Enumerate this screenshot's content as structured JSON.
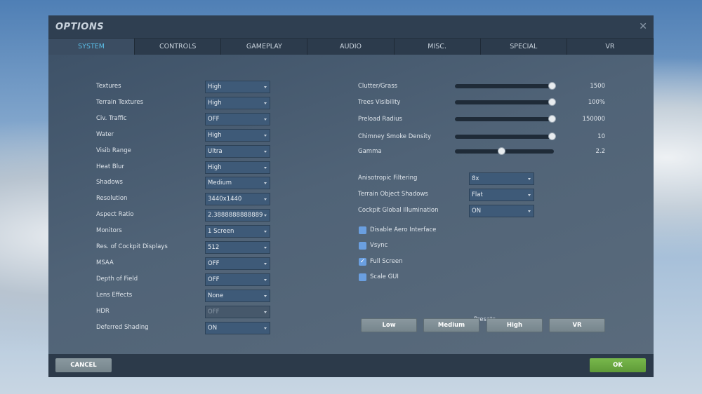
{
  "title": "OPTIONS",
  "tabs": [
    "SYSTEM",
    "CONTROLS",
    "GAMEPLAY",
    "AUDIO",
    "MISC.",
    "SPECIAL",
    "VR"
  ],
  "left_settings": [
    {
      "label": "Textures",
      "value": "High"
    },
    {
      "label": "Terrain Textures",
      "value": "High"
    },
    {
      "label": "Civ. Traffic",
      "value": "OFF"
    },
    {
      "label": "Water",
      "value": "High"
    },
    {
      "label": "Visib Range",
      "value": "Ultra"
    },
    {
      "label": "Heat Blur",
      "value": "High"
    },
    {
      "label": "Shadows",
      "value": "Medium"
    },
    {
      "label": "Resolution",
      "value": "3440x1440"
    },
    {
      "label": "Aspect Ratio",
      "value": "2.3888888888889"
    },
    {
      "label": "Monitors",
      "value": "1 Screen"
    },
    {
      "label": "Res. of Cockpit Displays",
      "value": "512"
    },
    {
      "label": "MSAA",
      "value": "OFF"
    },
    {
      "label": "Depth of Field",
      "value": "OFF"
    },
    {
      "label": "Lens Effects",
      "value": "None"
    },
    {
      "label": "HDR",
      "value": "OFF",
      "disabled": true
    },
    {
      "label": "Deferred Shading",
      "value": "ON"
    }
  ],
  "sliders": [
    {
      "label": "Clutter/Grass",
      "value": "1500",
      "fraction": 1.0
    },
    {
      "label": "Trees Visibility",
      "value": "100%",
      "fraction": 1.0
    },
    {
      "label": "Preload Radius",
      "value": "150000",
      "fraction": 1.0
    },
    {
      "label": "Chimney Smoke Density",
      "value": "10",
      "fraction": 1.0
    },
    {
      "label": "Gamma",
      "value": "2.2",
      "fraction": 0.48
    }
  ],
  "right_dropdowns": [
    {
      "label": "Anisotropic Filtering",
      "value": "8x"
    },
    {
      "label": "Terrain Object Shadows",
      "value": "Flat"
    },
    {
      "label": "Cockpit Global Illumination",
      "value": "ON"
    }
  ],
  "checkboxes": [
    {
      "label": "Disable Aero Interface",
      "checked": false
    },
    {
      "label": "Vsync",
      "checked": false
    },
    {
      "label": "Full Screen",
      "checked": true
    },
    {
      "label": "Scale GUI",
      "checked": false
    }
  ],
  "presets": {
    "label": "Presets",
    "buttons": [
      "Low",
      "Medium",
      "High",
      "VR"
    ]
  },
  "footer": {
    "cancel": "CANCEL",
    "ok": "OK"
  },
  "colors": {
    "accent": "#5bbfe8",
    "ok": "#6aa842",
    "checkbox": "#6a9fe0"
  }
}
